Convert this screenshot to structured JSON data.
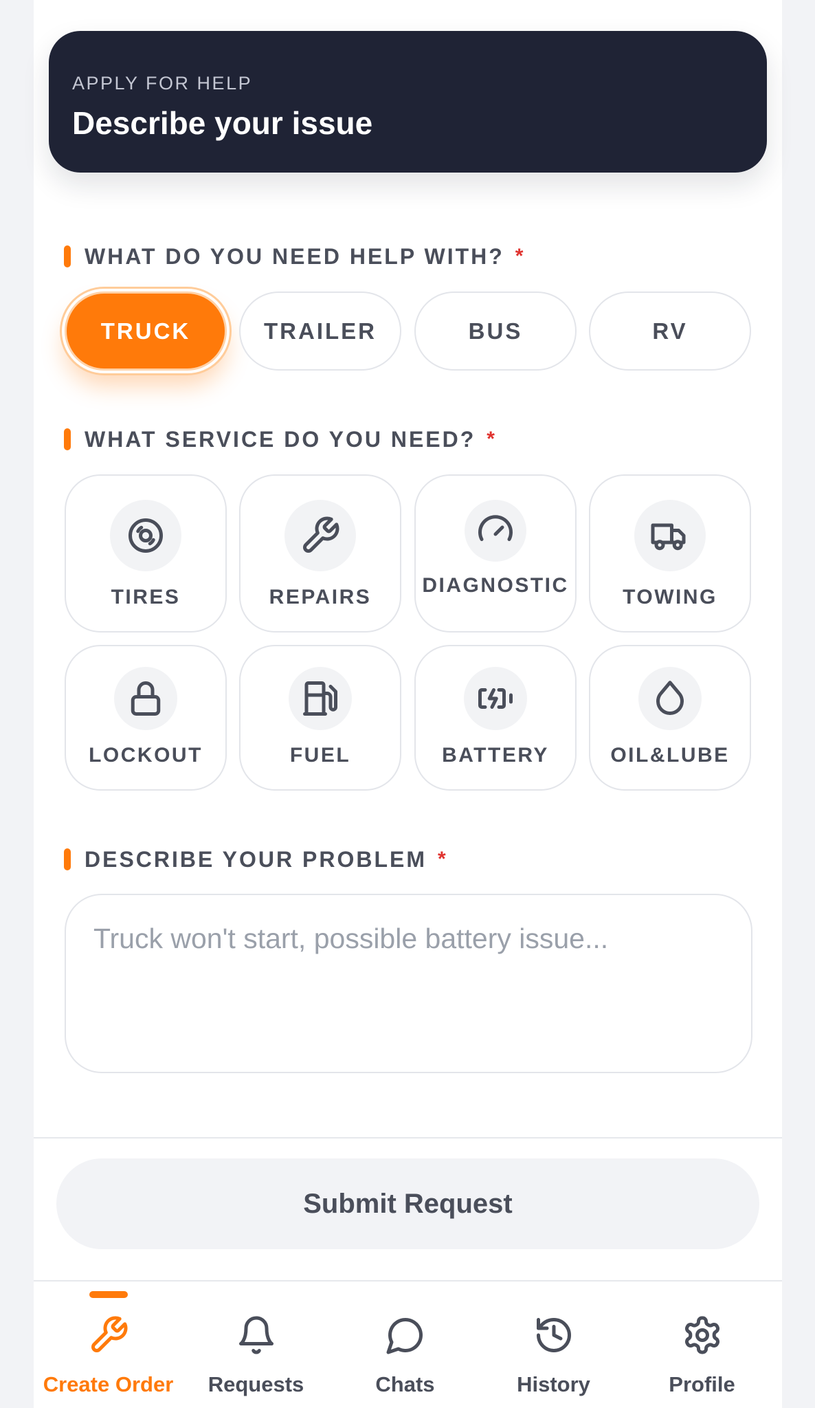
{
  "colors": {
    "accent": "#ff7a0a",
    "header_bg": "#1f2335",
    "required": "#e0332f",
    "text": "#4a4e5a"
  },
  "header": {
    "kicker": "APPLY FOR HELP",
    "title": "Describe your issue"
  },
  "vehicle_section": {
    "label": "WHAT DO YOU NEED HELP WITH?",
    "required_mark": "*",
    "options": [
      {
        "label": "TRUCK",
        "selected": true
      },
      {
        "label": "TRAILER",
        "selected": false
      },
      {
        "label": "BUS",
        "selected": false
      },
      {
        "label": "RV",
        "selected": false
      }
    ]
  },
  "service_section": {
    "label": "WHAT SERVICE DO YOU NEED?",
    "required_mark": "*",
    "options": [
      {
        "label": "TIRES",
        "icon": "tire-icon"
      },
      {
        "label": "REPAIRS",
        "icon": "wrench-icon"
      },
      {
        "label": "DIAGNOSTIC",
        "icon": "gauge-icon"
      },
      {
        "label": "TOWING",
        "icon": "truck-icon"
      },
      {
        "label": "LOCKOUT",
        "icon": "lock-icon"
      },
      {
        "label": "FUEL",
        "icon": "fuel-icon"
      },
      {
        "label": "BATTERY",
        "icon": "battery-icon"
      },
      {
        "label": "OIL&LUBE",
        "icon": "droplet-icon"
      }
    ]
  },
  "problem_section": {
    "label": "DESCRIBE YOUR PROBLEM",
    "required_mark": "*",
    "placeholder": "Truck won't start, possible battery issue...",
    "value": ""
  },
  "submit": {
    "label": "Submit Request"
  },
  "nav": {
    "items": [
      {
        "label": "Create Order",
        "icon": "wrench-icon",
        "active": true
      },
      {
        "label": "Requests",
        "icon": "bell-icon",
        "active": false
      },
      {
        "label": "Chats",
        "icon": "chat-bubble-icon",
        "active": false
      },
      {
        "label": "History",
        "icon": "history-icon",
        "active": false
      },
      {
        "label": "Profile",
        "icon": "gear-icon",
        "active": false
      }
    ]
  }
}
